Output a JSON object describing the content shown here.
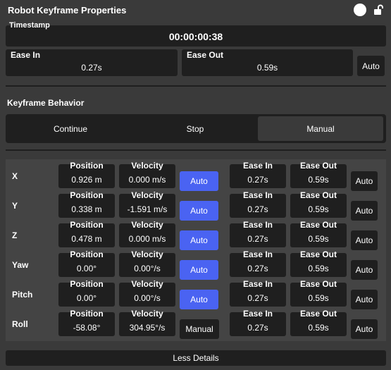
{
  "title": "Robot Keyframe Properties",
  "timestamp": {
    "label": "Timestamp",
    "value": "00:00:00:38"
  },
  "ease_in": {
    "label": "Ease In",
    "value": "0.27s"
  },
  "ease_out": {
    "label": "Ease Out",
    "value": "0.59s"
  },
  "auto_label": "Auto",
  "behavior": {
    "label": "Keyframe Behavior",
    "options": [
      "Continue",
      "Stop",
      "Manual"
    ],
    "selected": "Manual"
  },
  "axis_headers": {
    "position": "Position",
    "velocity": "Velocity",
    "ease_in": "Ease In",
    "ease_out": "Ease Out"
  },
  "axes": [
    {
      "name": "X",
      "position": "0.926 m",
      "velocity": "0.000 m/s",
      "velocity_mode": "Auto",
      "ease_in": "0.27s",
      "ease_out": "0.59s",
      "ease_mode": "Auto"
    },
    {
      "name": "Y",
      "position": "0.338 m",
      "velocity": "-1.591 m/s",
      "velocity_mode": "Auto",
      "ease_in": "0.27s",
      "ease_out": "0.59s",
      "ease_mode": "Auto"
    },
    {
      "name": "Z",
      "position": "0.478 m",
      "velocity": "0.000 m/s",
      "velocity_mode": "Auto",
      "ease_in": "0.27s",
      "ease_out": "0.59s",
      "ease_mode": "Auto"
    },
    {
      "name": "Yaw",
      "position": "0.00°",
      "velocity": "0.00°/s",
      "velocity_mode": "Auto",
      "ease_in": "0.27s",
      "ease_out": "0.59s",
      "ease_mode": "Auto"
    },
    {
      "name": "Pitch",
      "position": "0.00°",
      "velocity": "0.00°/s",
      "velocity_mode": "Auto",
      "ease_in": "0.27s",
      "ease_out": "0.59s",
      "ease_mode": "Auto"
    },
    {
      "name": "Roll",
      "position": "-58.08°",
      "velocity": "304.95°/s",
      "velocity_mode": "Manual",
      "ease_in": "0.27s",
      "ease_out": "0.59s",
      "ease_mode": "Auto"
    }
  ],
  "less_details": "Less Details",
  "colors": {
    "accent": "#4a63f2",
    "panel": "#3a3a3a",
    "field": "#1f1f1f",
    "selected": "#3a3a3a"
  }
}
